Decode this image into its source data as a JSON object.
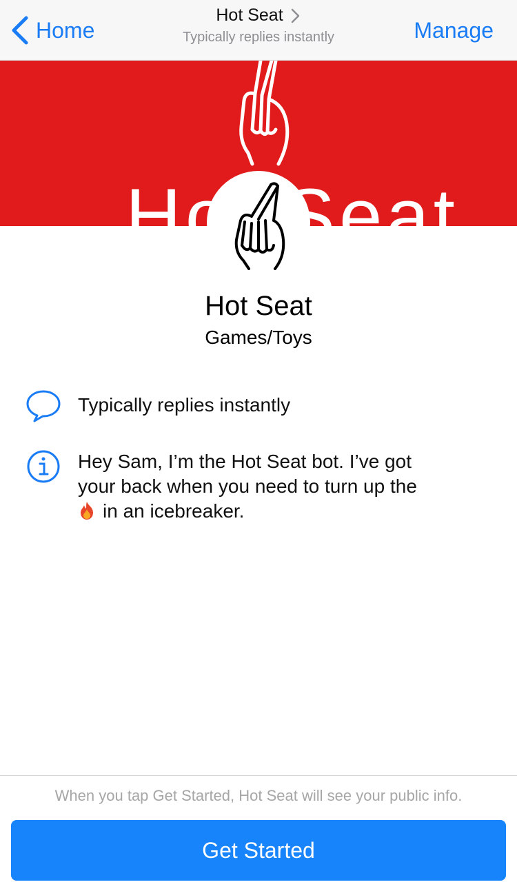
{
  "navbar": {
    "back_label": "Home",
    "title": "Hot Seat",
    "subtitle": "Typically replies instantly",
    "manage_label": "Manage"
  },
  "cover": {
    "brand_color": "#e11b1b",
    "logo_text": "Hot Seat"
  },
  "profile": {
    "name": "Hot Seat",
    "category": "Games/Toys"
  },
  "info": {
    "response": "Typically replies instantly",
    "about_line1": "Hey Sam, I’m the Hot Seat bot. I’ve got",
    "about_line2": "your back when you need to turn up the",
    "about_line3": "in an icebreaker."
  },
  "footer": {
    "notice": "When you tap Get Started, Hot Seat will see your public info.",
    "cta_label": "Get Started",
    "cta_color": "#1784fb"
  },
  "icons": {
    "back": "chevron-left-icon",
    "title_chevron": "chevron-right-icon",
    "response": "speech-bubble-icon",
    "about": "info-icon",
    "emoji": "fire-icon",
    "logo": "crossed-fingers-icon"
  }
}
